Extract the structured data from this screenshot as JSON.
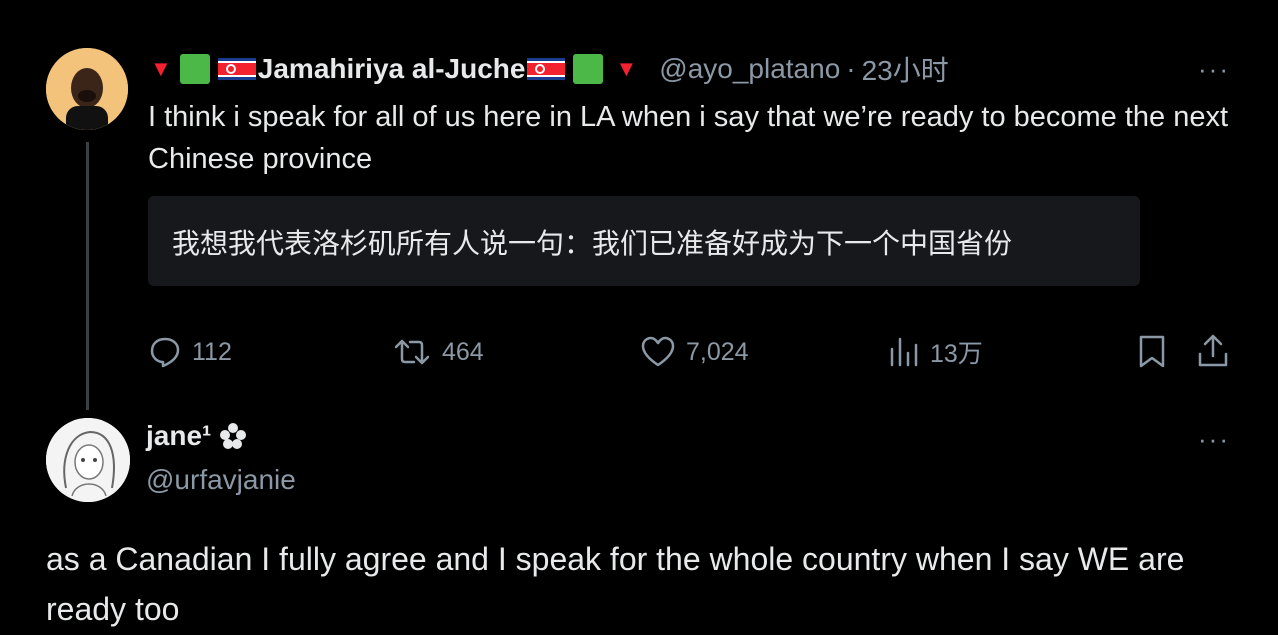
{
  "tweet": {
    "display_name": "Jamahiriya al-Juche",
    "handle": "@ayo_platano",
    "separator": "·",
    "time": "23小时",
    "text": "I think i speak for all of us here in LA when i say that we’re ready to become the next Chinese province",
    "translation": "我想我代表洛杉矶所有人说一句：我们已准备好成为下一个中国省份",
    "more": "···",
    "actions": {
      "replies": "112",
      "retweets": "464",
      "likes": "7,024",
      "views": "13万"
    },
    "colors": {
      "flag_red": "#f4212e",
      "flag_blue": "#1a3c8f",
      "square_green": "#4cb848"
    }
  },
  "reply": {
    "display_name": "jane¹",
    "handle": "@urfavjanie",
    "more": "···",
    "text": "as a Canadian I fully agree and I speak for the whole country when I say WE are ready too"
  }
}
